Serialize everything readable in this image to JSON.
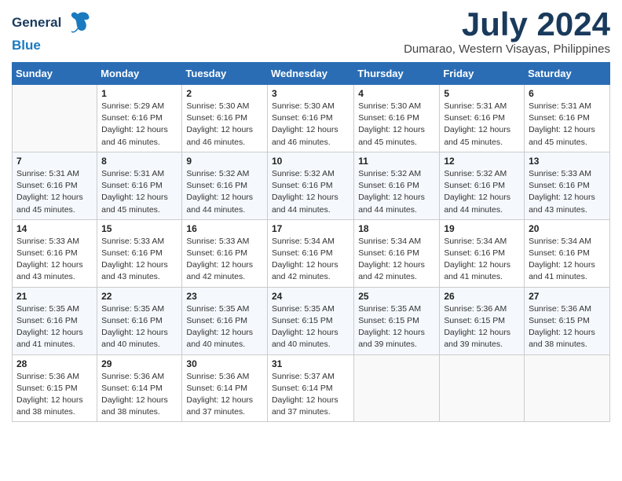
{
  "header": {
    "logo_general": "General",
    "logo_blue": "Blue",
    "month_year": "July 2024",
    "location": "Dumarao, Western Visayas, Philippines"
  },
  "days_of_week": [
    "Sunday",
    "Monday",
    "Tuesday",
    "Wednesday",
    "Thursday",
    "Friday",
    "Saturday"
  ],
  "weeks": [
    [
      {
        "day": "",
        "sunrise": "",
        "sunset": "",
        "daylight": ""
      },
      {
        "day": "1",
        "sunrise": "Sunrise: 5:29 AM",
        "sunset": "Sunset: 6:16 PM",
        "daylight": "Daylight: 12 hours and 46 minutes."
      },
      {
        "day": "2",
        "sunrise": "Sunrise: 5:30 AM",
        "sunset": "Sunset: 6:16 PM",
        "daylight": "Daylight: 12 hours and 46 minutes."
      },
      {
        "day": "3",
        "sunrise": "Sunrise: 5:30 AM",
        "sunset": "Sunset: 6:16 PM",
        "daylight": "Daylight: 12 hours and 46 minutes."
      },
      {
        "day": "4",
        "sunrise": "Sunrise: 5:30 AM",
        "sunset": "Sunset: 6:16 PM",
        "daylight": "Daylight: 12 hours and 45 minutes."
      },
      {
        "day": "5",
        "sunrise": "Sunrise: 5:31 AM",
        "sunset": "Sunset: 6:16 PM",
        "daylight": "Daylight: 12 hours and 45 minutes."
      },
      {
        "day": "6",
        "sunrise": "Sunrise: 5:31 AM",
        "sunset": "Sunset: 6:16 PM",
        "daylight": "Daylight: 12 hours and 45 minutes."
      }
    ],
    [
      {
        "day": "7",
        "sunrise": "Sunrise: 5:31 AM",
        "sunset": "Sunset: 6:16 PM",
        "daylight": "Daylight: 12 hours and 45 minutes."
      },
      {
        "day": "8",
        "sunrise": "Sunrise: 5:31 AM",
        "sunset": "Sunset: 6:16 PM",
        "daylight": "Daylight: 12 hours and 45 minutes."
      },
      {
        "day": "9",
        "sunrise": "Sunrise: 5:32 AM",
        "sunset": "Sunset: 6:16 PM",
        "daylight": "Daylight: 12 hours and 44 minutes."
      },
      {
        "day": "10",
        "sunrise": "Sunrise: 5:32 AM",
        "sunset": "Sunset: 6:16 PM",
        "daylight": "Daylight: 12 hours and 44 minutes."
      },
      {
        "day": "11",
        "sunrise": "Sunrise: 5:32 AM",
        "sunset": "Sunset: 6:16 PM",
        "daylight": "Daylight: 12 hours and 44 minutes."
      },
      {
        "day": "12",
        "sunrise": "Sunrise: 5:32 AM",
        "sunset": "Sunset: 6:16 PM",
        "daylight": "Daylight: 12 hours and 44 minutes."
      },
      {
        "day": "13",
        "sunrise": "Sunrise: 5:33 AM",
        "sunset": "Sunset: 6:16 PM",
        "daylight": "Daylight: 12 hours and 43 minutes."
      }
    ],
    [
      {
        "day": "14",
        "sunrise": "Sunrise: 5:33 AM",
        "sunset": "Sunset: 6:16 PM",
        "daylight": "Daylight: 12 hours and 43 minutes."
      },
      {
        "day": "15",
        "sunrise": "Sunrise: 5:33 AM",
        "sunset": "Sunset: 6:16 PM",
        "daylight": "Daylight: 12 hours and 43 minutes."
      },
      {
        "day": "16",
        "sunrise": "Sunrise: 5:33 AM",
        "sunset": "Sunset: 6:16 PM",
        "daylight": "Daylight: 12 hours and 42 minutes."
      },
      {
        "day": "17",
        "sunrise": "Sunrise: 5:34 AM",
        "sunset": "Sunset: 6:16 PM",
        "daylight": "Daylight: 12 hours and 42 minutes."
      },
      {
        "day": "18",
        "sunrise": "Sunrise: 5:34 AM",
        "sunset": "Sunset: 6:16 PM",
        "daylight": "Daylight: 12 hours and 42 minutes."
      },
      {
        "day": "19",
        "sunrise": "Sunrise: 5:34 AM",
        "sunset": "Sunset: 6:16 PM",
        "daylight": "Daylight: 12 hours and 41 minutes."
      },
      {
        "day": "20",
        "sunrise": "Sunrise: 5:34 AM",
        "sunset": "Sunset: 6:16 PM",
        "daylight": "Daylight: 12 hours and 41 minutes."
      }
    ],
    [
      {
        "day": "21",
        "sunrise": "Sunrise: 5:35 AM",
        "sunset": "Sunset: 6:16 PM",
        "daylight": "Daylight: 12 hours and 41 minutes."
      },
      {
        "day": "22",
        "sunrise": "Sunrise: 5:35 AM",
        "sunset": "Sunset: 6:16 PM",
        "daylight": "Daylight: 12 hours and 40 minutes."
      },
      {
        "day": "23",
        "sunrise": "Sunrise: 5:35 AM",
        "sunset": "Sunset: 6:16 PM",
        "daylight": "Daylight: 12 hours and 40 minutes."
      },
      {
        "day": "24",
        "sunrise": "Sunrise: 5:35 AM",
        "sunset": "Sunset: 6:15 PM",
        "daylight": "Daylight: 12 hours and 40 minutes."
      },
      {
        "day": "25",
        "sunrise": "Sunrise: 5:35 AM",
        "sunset": "Sunset: 6:15 PM",
        "daylight": "Daylight: 12 hours and 39 minutes."
      },
      {
        "day": "26",
        "sunrise": "Sunrise: 5:36 AM",
        "sunset": "Sunset: 6:15 PM",
        "daylight": "Daylight: 12 hours and 39 minutes."
      },
      {
        "day": "27",
        "sunrise": "Sunrise: 5:36 AM",
        "sunset": "Sunset: 6:15 PM",
        "daylight": "Daylight: 12 hours and 38 minutes."
      }
    ],
    [
      {
        "day": "28",
        "sunrise": "Sunrise: 5:36 AM",
        "sunset": "Sunset: 6:15 PM",
        "daylight": "Daylight: 12 hours and 38 minutes."
      },
      {
        "day": "29",
        "sunrise": "Sunrise: 5:36 AM",
        "sunset": "Sunset: 6:14 PM",
        "daylight": "Daylight: 12 hours and 38 minutes."
      },
      {
        "day": "30",
        "sunrise": "Sunrise: 5:36 AM",
        "sunset": "Sunset: 6:14 PM",
        "daylight": "Daylight: 12 hours and 37 minutes."
      },
      {
        "day": "31",
        "sunrise": "Sunrise: 5:37 AM",
        "sunset": "Sunset: 6:14 PM",
        "daylight": "Daylight: 12 hours and 37 minutes."
      },
      {
        "day": "",
        "sunrise": "",
        "sunset": "",
        "daylight": ""
      },
      {
        "day": "",
        "sunrise": "",
        "sunset": "",
        "daylight": ""
      },
      {
        "day": "",
        "sunrise": "",
        "sunset": "",
        "daylight": ""
      }
    ]
  ]
}
